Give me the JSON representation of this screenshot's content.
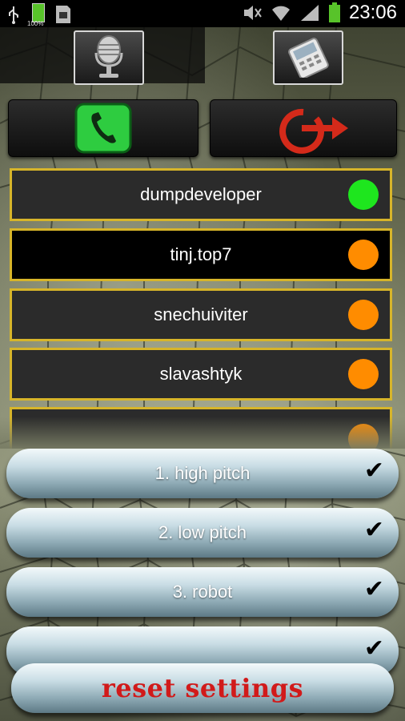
{
  "status_bar": {
    "time": "23:06",
    "battery_percent": "100%",
    "icons": [
      "usb-icon",
      "battery-small-icon",
      "sd-card-icon",
      "mute-icon",
      "wifi-icon",
      "signal-icon",
      "battery-icon"
    ]
  },
  "top_tabs": [
    {
      "name": "microphone-tab",
      "icon": "microphone-icon"
    },
    {
      "name": "phone-tab",
      "icon": "mobile-phone-icon"
    }
  ],
  "actions": [
    {
      "name": "call-button",
      "icon": "phone-call-icon",
      "color": "#2ecc40"
    },
    {
      "name": "exit-button",
      "icon": "power-arrow-icon",
      "color": "#d42a1a"
    }
  ],
  "contacts": [
    {
      "label": "dumpdeveloper",
      "status_color": "#1ee61e"
    },
    {
      "label": "tinj.top7",
      "status_color": "#ff8c00"
    },
    {
      "label": "snechuiviter",
      "status_color": "#ff8c00"
    },
    {
      "label": "slavashtyk",
      "status_color": "#ff8c00"
    }
  ],
  "effects": [
    {
      "label": "1. high pitch",
      "checked": true
    },
    {
      "label": "2. low pitch",
      "checked": true
    },
    {
      "label": "3. robot",
      "checked": true
    }
  ],
  "check_mark": "✔",
  "reset_label": "reset settings"
}
